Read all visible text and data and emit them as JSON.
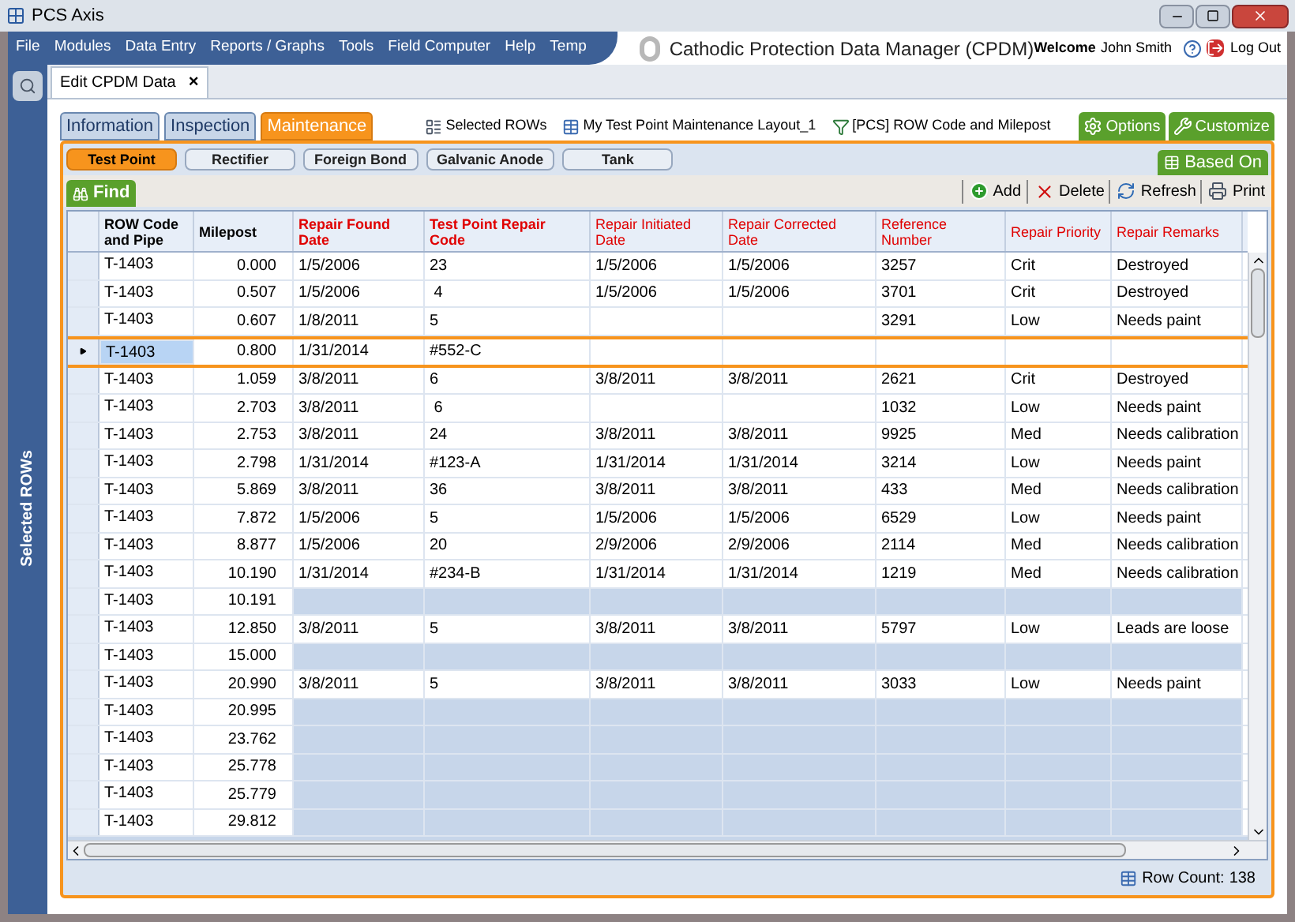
{
  "window": {
    "title": "PCS Axis"
  },
  "menu": [
    "File",
    "Modules",
    "Data Entry",
    "Reports / Graphs",
    "Tools",
    "Field Computer",
    "Help",
    "Temp"
  ],
  "app_title": "Cathodic Protection Data Manager (CPDM)",
  "user": {
    "welcome": "Welcome",
    "name": "John Smith",
    "logout": "Log Out"
  },
  "side_panel": {
    "label": "Selected ROWs"
  },
  "doc_tab": {
    "label": "Edit CPDM Data",
    "close": "×"
  },
  "tabs": [
    {
      "label": "Information",
      "selected": false
    },
    {
      "label": "Inspection",
      "selected": false
    },
    {
      "label": "Maintenance",
      "selected": true
    }
  ],
  "info_items": [
    {
      "kind": "selection",
      "label": "Selected ROWs"
    },
    {
      "kind": "layout",
      "label": "My Test Point Maintenance Layout_1"
    },
    {
      "kind": "filter",
      "label": "[PCS] ROW Code and Milepost"
    }
  ],
  "top_buttons": [
    {
      "kind": "options",
      "label": "Options"
    },
    {
      "kind": "customize",
      "label": "Customize"
    }
  ],
  "subtabs": [
    {
      "label": "Test Point",
      "selected": true
    },
    {
      "label": "Rectifier",
      "selected": false
    },
    {
      "label": "Foreign Bond",
      "selected": false
    },
    {
      "label": "Galvanic Anode",
      "selected": false
    },
    {
      "label": "Tank",
      "selected": false
    }
  ],
  "based_on": "Based On",
  "find": "Find",
  "actions": [
    {
      "kind": "add",
      "label": "Add"
    },
    {
      "kind": "delete",
      "label": "Delete"
    },
    {
      "kind": "refresh",
      "label": "Refresh"
    },
    {
      "kind": "print",
      "label": "Print"
    }
  ],
  "table": {
    "columns": [
      {
        "label": "ROW Code and Pipe",
        "kind": "key"
      },
      {
        "label": "Milepost",
        "kind": "key"
      },
      {
        "label": "Repair Found Date",
        "kind": "required"
      },
      {
        "label": "Test Point Repair Code",
        "kind": "required"
      },
      {
        "label": "Repair Initiated Date",
        "kind": "optional"
      },
      {
        "label": "Repair Corrected Date",
        "kind": "optional"
      },
      {
        "label": "Reference Number",
        "kind": "optional"
      },
      {
        "label": "Repair Priority",
        "kind": "optional"
      },
      {
        "label": "Repair Remarks",
        "kind": "optional"
      }
    ],
    "rows": [
      {
        "kind": "record",
        "selected": false,
        "cells": [
          "T-1403",
          "0.000",
          "1/5/2006",
          "23",
          "1/5/2006",
          "1/5/2006",
          "3257",
          "Crit",
          "Destroyed"
        ]
      },
      {
        "kind": "record",
        "selected": false,
        "cells": [
          "T-1403",
          "0.507",
          "1/5/2006",
          " 4",
          "1/5/2006",
          "1/5/2006",
          "3701",
          "Crit",
          "Destroyed"
        ]
      },
      {
        "kind": "record",
        "selected": false,
        "cells": [
          "T-1403",
          "0.607",
          "1/8/2011",
          "5",
          null,
          null,
          "3291",
          "Low",
          "Needs paint"
        ]
      },
      {
        "kind": "record",
        "selected": true,
        "cells": [
          "T-1403",
          "0.800",
          "1/31/2014",
          "#552-C",
          null,
          null,
          null,
          null,
          null
        ]
      },
      {
        "kind": "record",
        "selected": false,
        "cells": [
          "T-1403",
          "1.059",
          "3/8/2011",
          "6",
          "3/8/2011",
          "3/8/2011",
          "2621",
          "Crit",
          "Destroyed"
        ]
      },
      {
        "kind": "record",
        "selected": false,
        "cells": [
          "T-1403",
          "2.703",
          "3/8/2011",
          " 6",
          null,
          null,
          "1032",
          "Low",
          "Needs paint"
        ]
      },
      {
        "kind": "record",
        "selected": false,
        "cells": [
          "T-1403",
          "2.753",
          "3/8/2011",
          "24",
          "3/8/2011",
          "3/8/2011",
          "9925",
          "Med",
          "Needs calibration"
        ]
      },
      {
        "kind": "record",
        "selected": false,
        "cells": [
          "T-1403",
          "2.798",
          "1/31/2014",
          "#123-A",
          "1/31/2014",
          "1/31/2014",
          "3214",
          "Low",
          "Needs paint"
        ]
      },
      {
        "kind": "record",
        "selected": false,
        "cells": [
          "T-1403",
          "5.869",
          "3/8/2011",
          "36",
          "3/8/2011",
          "3/8/2011",
          "433",
          "Med",
          "Needs calibration"
        ]
      },
      {
        "kind": "record",
        "selected": false,
        "cells": [
          "T-1403",
          "7.872",
          "1/5/2006",
          "5",
          "1/5/2006",
          "1/5/2006",
          "6529",
          "Low",
          "Needs paint"
        ]
      },
      {
        "kind": "record",
        "selected": false,
        "cells": [
          "T-1403",
          "8.877",
          "1/5/2006",
          "20",
          "2/9/2006",
          "2/9/2006",
          "2114",
          "Med",
          "Needs calibration"
        ]
      },
      {
        "kind": "record",
        "selected": false,
        "cells": [
          "T-1403",
          "10.190",
          "1/31/2014",
          "#234-B",
          "1/31/2014",
          "1/31/2014",
          "1219",
          "Med",
          "Needs calibration"
        ]
      },
      {
        "kind": "blank",
        "selected": false,
        "cells": [
          "T-1403",
          "10.191"
        ]
      },
      {
        "kind": "record",
        "selected": false,
        "cells": [
          "T-1403",
          "12.850",
          "3/8/2011",
          "5",
          "3/8/2011",
          "3/8/2011",
          "5797",
          "Low",
          "Leads are loose"
        ]
      },
      {
        "kind": "blank",
        "selected": false,
        "cells": [
          "T-1403",
          "15.000"
        ]
      },
      {
        "kind": "record",
        "selected": false,
        "cells": [
          "T-1403",
          "20.990",
          "3/8/2011",
          "5",
          "3/8/2011",
          "3/8/2011",
          "3033",
          "Low",
          "Needs paint"
        ]
      },
      {
        "kind": "blank",
        "selected": false,
        "cells": [
          "T-1403",
          "20.995"
        ]
      },
      {
        "kind": "blank",
        "selected": false,
        "cells": [
          "T-1403",
          "23.762"
        ]
      },
      {
        "kind": "blank",
        "selected": false,
        "cells": [
          "T-1403",
          "25.778"
        ]
      },
      {
        "kind": "blank",
        "selected": false,
        "cells": [
          "T-1403",
          "25.779"
        ]
      },
      {
        "kind": "blank",
        "selected": false,
        "cells": [
          "T-1403",
          "29.812"
        ]
      }
    ]
  },
  "status_bar": {
    "row_count": "Row Count:",
    "count": "138"
  }
}
